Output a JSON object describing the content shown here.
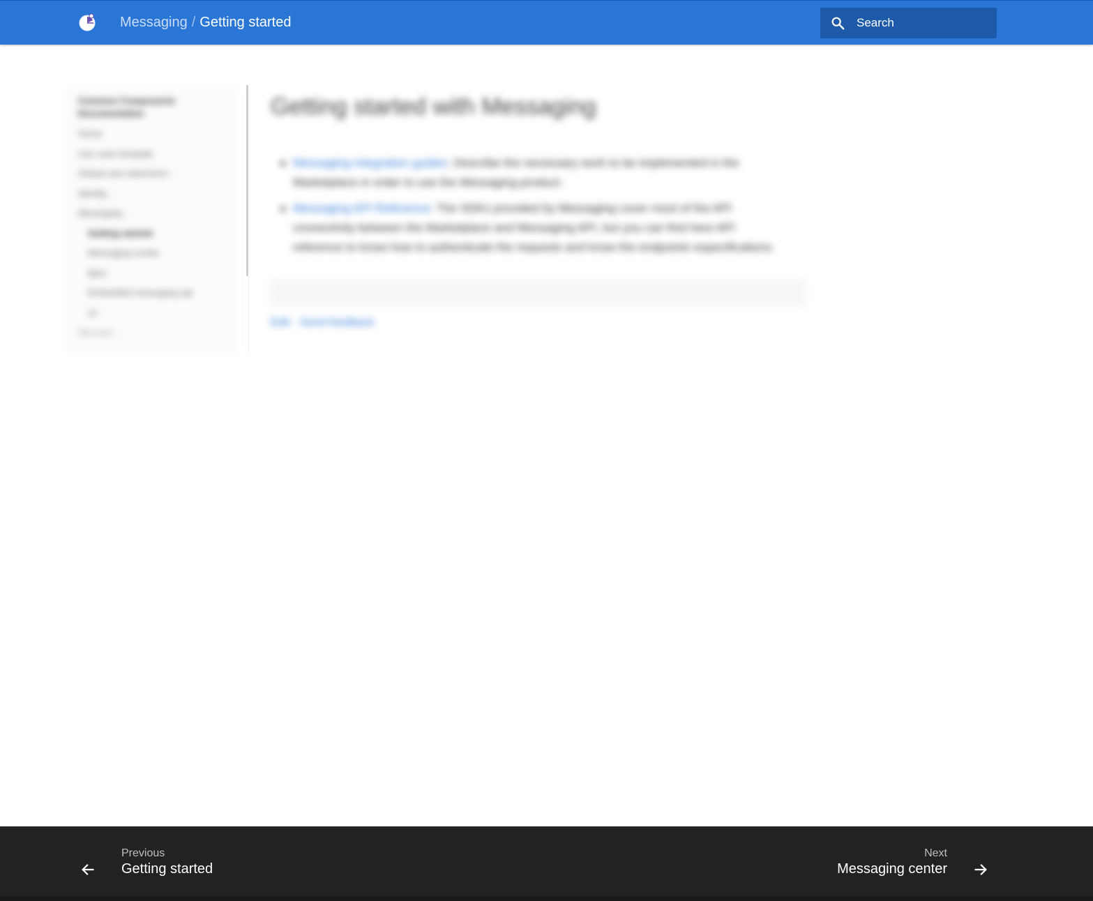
{
  "header": {
    "breadcrumb": {
      "parent": "Messaging",
      "separator": "/",
      "current": "Getting started"
    },
    "search": {
      "placeholder": "Search",
      "icon": "search-icon"
    },
    "logo_icon": "app-logo-icon",
    "colors": {
      "primary": "#2a76d6",
      "search_bg": "#1d5aaa"
    }
  },
  "sidebar": {
    "title": "Common Components Documentation",
    "items": [
      {
        "label": "Home"
      },
      {
        "label": "Use case template"
      },
      {
        "label": "Global user detections",
        "caret": "›"
      },
      {
        "label": "Identity",
        "caret": "›"
      },
      {
        "label": "Messaging",
        "caret": "›"
      },
      {
        "label": "Getting started"
      },
      {
        "label": "Messaging center"
      },
      {
        "label": "Bpm"
      },
      {
        "label": "Embedded messaging api"
      },
      {
        "label": "UI"
      },
      {
        "label": "Microsoft",
        "caret": "›"
      }
    ]
  },
  "content": {
    "title": "Getting started with Messaging",
    "bullets": [
      {
        "link": "Messaging integration guides",
        "text": ": Describe the necessary work to be implemented in the Marketplace in order to use the Messaging product."
      },
      {
        "link": "Messaging API Reference",
        "text": ": The SDKs provided by Messaging cover most of the API connectivity between the Marketplace and Messaging API, but you can find here API reference to know how to authenticate the requests and know the endpoints especifications."
      }
    ],
    "edit_links": "Edit · Send feedback"
  },
  "footer": {
    "previous": {
      "direction": "Previous",
      "title": "Getting started",
      "icon": "arrow-left-icon"
    },
    "next": {
      "direction": "Next",
      "title": "Messaging center",
      "icon": "arrow-right-icon"
    },
    "colors": {
      "background": "#222222"
    }
  }
}
